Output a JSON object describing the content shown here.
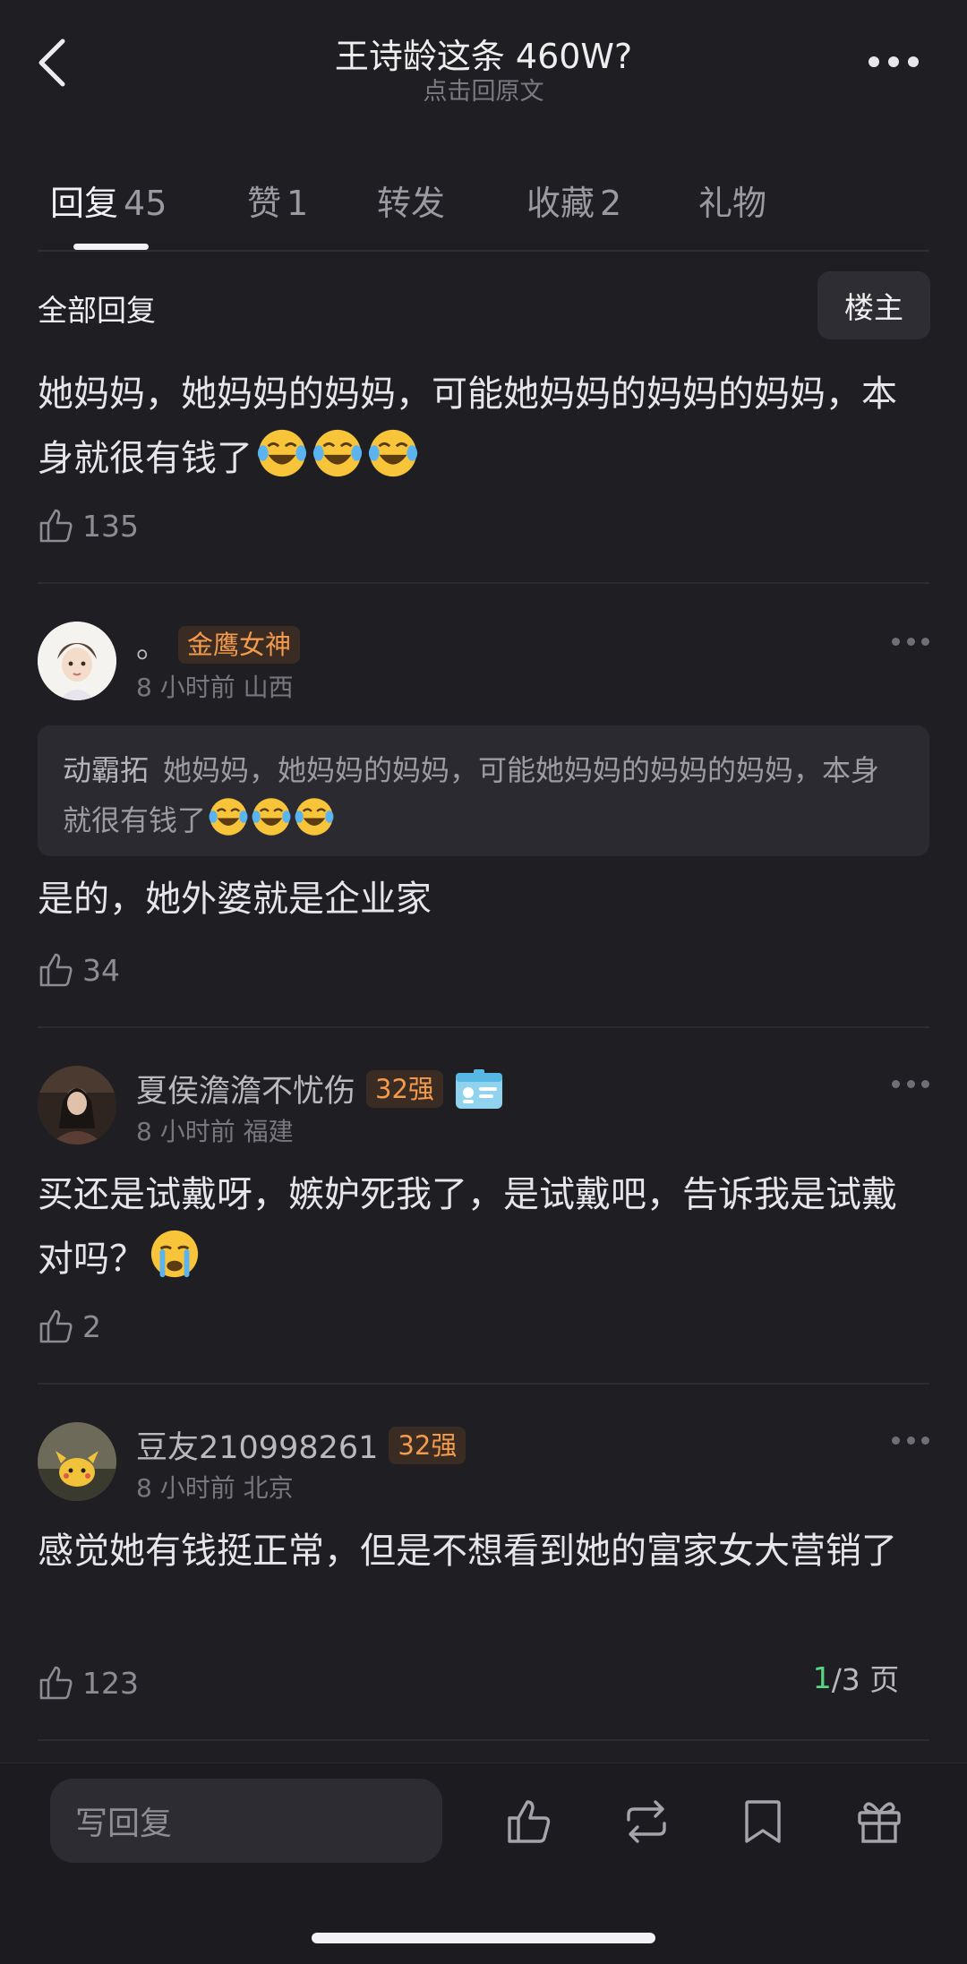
{
  "header": {
    "title": "王诗龄这条 460W?",
    "subtitle": "点击回原文"
  },
  "tabs": [
    {
      "label": "回复",
      "count": "45",
      "active": true
    },
    {
      "label": "赞",
      "count": "1"
    },
    {
      "label": "转发",
      "count": ""
    },
    {
      "label": "收藏",
      "count": "2"
    },
    {
      "label": "礼物",
      "count": ""
    }
  ],
  "section": {
    "title": "全部回复",
    "op_button": "楼主"
  },
  "main_post": {
    "text": "她妈妈，她妈妈的妈妈，可能她妈妈的妈妈的妈妈，本身就很有钱了",
    "emoji": "laughing-crying-emoji",
    "likes": "135"
  },
  "comments": [
    {
      "username": "。",
      "badge": "金鹰女神",
      "time": "8 小时前",
      "location": "山西",
      "quote_name": "动霸拓",
      "quote_text": "她妈妈，她妈妈的妈妈，可能她妈妈的妈妈的妈妈，本身就很有钱了",
      "text": "是的，她外婆就是企业家",
      "likes": "34"
    },
    {
      "username": "夏侯澹澹不忧伤",
      "badge": "32强",
      "time": "8 小时前",
      "location": "福建",
      "text": "买还是试戴呀，嫉妒死我了，是试戴吧，告诉我是试戴对吗？",
      "emoji": "crying-emoji",
      "likes": "2"
    },
    {
      "username": "豆友210998261",
      "badge": "32强",
      "time": "8 小时前",
      "location": "北京",
      "text": "感觉她有钱挺正常，但是不想看到她的富家女大营销了",
      "likes": "123"
    }
  ],
  "pager": {
    "current": "1",
    "total": "/3 页"
  },
  "bottom_bar": {
    "reply_placeholder": "写回复"
  },
  "colors": {
    "background": "#1f1f23",
    "badge_text": "#f39a4d",
    "pager_current": "#59d680"
  }
}
